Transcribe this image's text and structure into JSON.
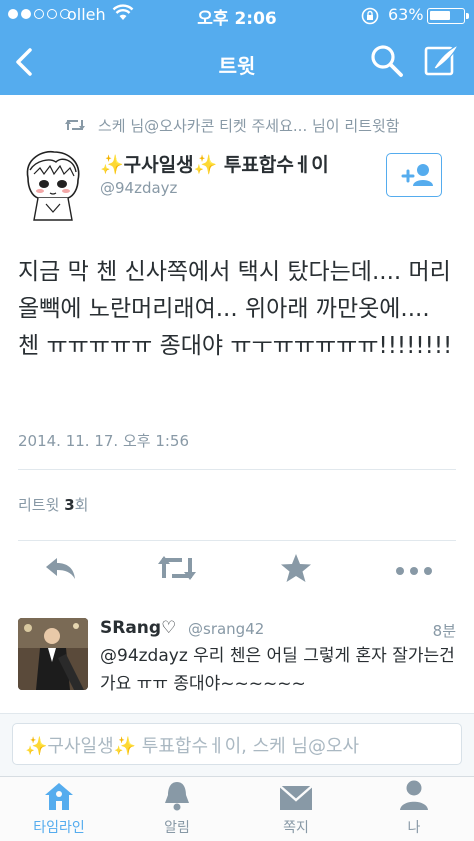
{
  "status_bar": {
    "carrier": "olleh",
    "time": "오후 2:06",
    "battery_pct": "63%",
    "battery_level": 0.63,
    "signal_bars": 2
  },
  "nav": {
    "title": "트윗"
  },
  "retweet_context": "스케 님@오사카콘 티켓 주세요... 님이 리트윗함",
  "tweet": {
    "name_pre": "✨",
    "name_a": "구사일생",
    "name_mid": "✨",
    "name_b": " 투표합수ㅔ이",
    "handle": "@94zdayz",
    "text": "지금 막 첸 신사쪽에서 택시 탔다는데.... 머리 올빽에 노란머리래여... 위아래 까만옷에.... 첸 ㅠㅠㅠㅠㅠ 종대야 ㅠㅜㅠㅠㅠㅠㅠ!!!!!!!!",
    "timestamp": "2014. 11. 17. 오후 1:56",
    "retweet_label": "리트윗",
    "retweet_count": "3",
    "retweet_suffix": "회"
  },
  "reply": {
    "name": "SRang♡",
    "handle": "@srang42",
    "time": "8분",
    "text": "@94zdayz 우리 첸은 어딜 그렇게 혼자 잘가는건가요 ㅠㅠ 종대야~~~~~~"
  },
  "compose": {
    "placeholder": "✨구사일생✨ 투표합수ㅔ이, 스케 님@오사"
  },
  "tabs": [
    {
      "label": "타임라인",
      "icon": "home-icon"
    },
    {
      "label": "알림",
      "icon": "bell-icon"
    },
    {
      "label": "쪽지",
      "icon": "envelope-icon"
    },
    {
      "label": "나",
      "icon": "person-icon"
    }
  ],
  "colors": {
    "brand": "#55acee",
    "muted": "#8899a6",
    "text": "#292f33",
    "sparkle": "#f5b800"
  }
}
